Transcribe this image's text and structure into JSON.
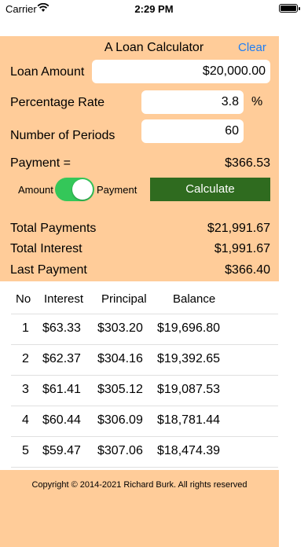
{
  "status_bar": {
    "carrier": "Carrier",
    "time": "2:29 PM"
  },
  "header": {
    "title": "A Loan Calculator",
    "clear_label": "Clear"
  },
  "form": {
    "loan_amount_label": "Loan Amount",
    "loan_amount_value": "$20,000.00",
    "rate_label": "Percentage Rate",
    "rate_value": "3.8",
    "rate_unit": "%",
    "periods_label": "Number of Periods",
    "periods_value": "60",
    "payment_label": "Payment =",
    "payment_value": "$366.53",
    "toggle_left_label": "Amount",
    "toggle_right_label": "Payment",
    "calculate_label": "Calculate"
  },
  "summary": {
    "total_payments_label": "Total Payments",
    "total_payments_value": "$21,991.67",
    "total_interest_label": "Total Interest",
    "total_interest_value": "$1,991.67",
    "last_payment_label": "Last Payment",
    "last_payment_value": "$366.40"
  },
  "table": {
    "headers": [
      "No",
      "Interest",
      "Principal",
      "Balance"
    ],
    "rows": [
      [
        "1",
        "$63.33",
        "$303.20",
        "$19,696.80"
      ],
      [
        "2",
        "$62.37",
        "$304.16",
        "$19,392.65"
      ],
      [
        "3",
        "$61.41",
        "$305.12",
        "$19,087.53"
      ],
      [
        "4",
        "$60.44",
        "$306.09",
        "$18,781.44"
      ],
      [
        "5",
        "$59.47",
        "$307.06",
        "$18,474.39"
      ]
    ]
  },
  "footer": {
    "copyright": "Copyright © 2014-2021 Richard Burk. All rights reserved"
  }
}
